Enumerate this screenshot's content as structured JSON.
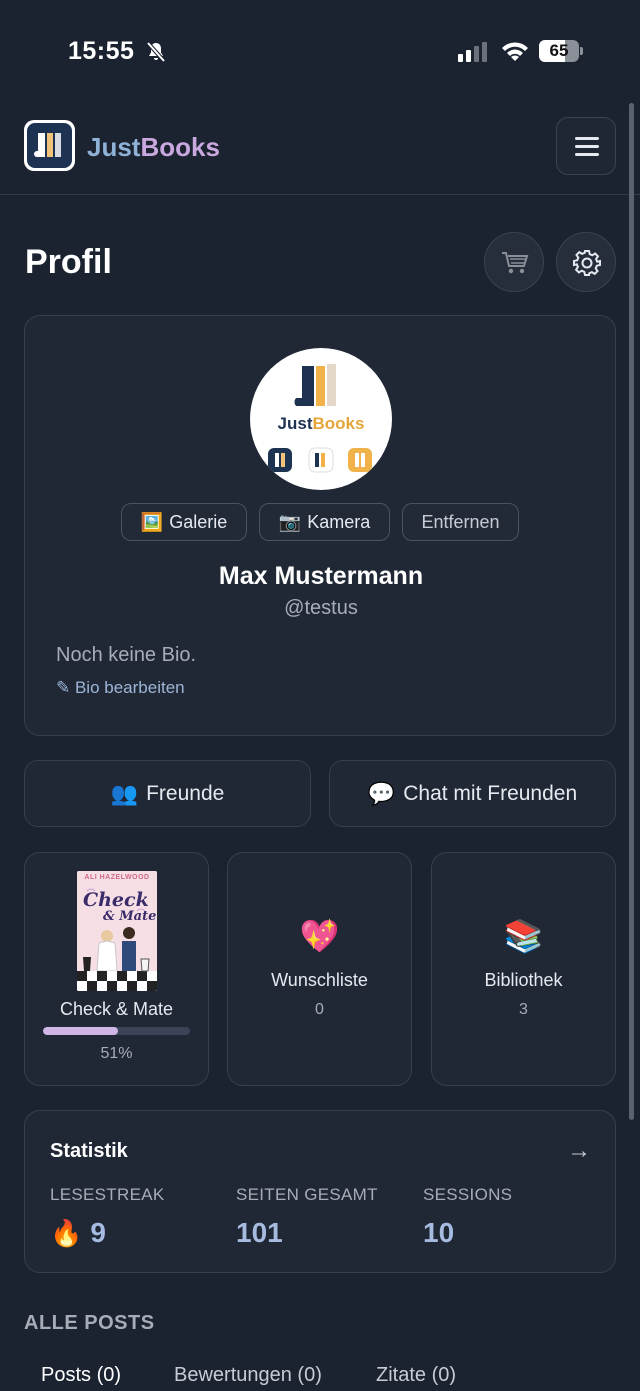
{
  "status_bar": {
    "time": "15:55",
    "battery_percent": "65",
    "battery_level": 0.65,
    "icons": [
      "bell-slash-icon",
      "signal-icon",
      "wifi-icon",
      "battery-icon"
    ]
  },
  "header": {
    "brand_part1": "Just",
    "brand_part2": "Books",
    "logo_icon": "justbooks-logo",
    "menu_icon": "hamburger-menu-icon"
  },
  "page": {
    "title": "Profil",
    "cart_icon": "cart-icon",
    "settings_icon": "gear-icon"
  },
  "profile": {
    "avatar_brand_part1": "Just",
    "avatar_brand_part2": "Books",
    "gallery_emoji": "🖼️",
    "gallery_label": "Galerie",
    "camera_emoji": "📷",
    "camera_label": "Kamera",
    "remove_label": "Entfernen",
    "name": "Max Mustermann",
    "handle": "@testus",
    "bio": "Noch keine Bio.",
    "edit_bio": "✎ Bio bearbeiten"
  },
  "actions": {
    "friends_emoji": "👥",
    "friends_label": "Freunde",
    "chat_emoji": "💬",
    "chat_label": "Chat mit Freunden"
  },
  "tiles": {
    "current_book": {
      "cover_author": "ALI HAZELWOOD",
      "cover_title_1": "Check",
      "cover_title_2": "& Mate",
      "title": "Check & Mate",
      "progress": 0.51,
      "progress_label": "51%"
    },
    "wishlist": {
      "emoji": "💖",
      "label": "Wunschliste",
      "count": "0"
    },
    "library": {
      "emoji": "📚",
      "label": "Bibliothek",
      "count": "3"
    }
  },
  "stats": {
    "title": "Statistik",
    "arrow": "→",
    "streak_label": "LESESTREAK",
    "streak_emoji": "🔥",
    "streak_value": "9",
    "pages_label": "SEITEN GESAMT",
    "pages_value": "101",
    "sessions_label": "SESSIONS",
    "sessions_value": "10"
  },
  "posts": {
    "section_title": "ALLE POSTS",
    "tabs": [
      "Posts (0)",
      "Bewertungen (0)",
      "Zitate (0)"
    ]
  },
  "colors": {
    "background": "#1b2230",
    "card": "#202735",
    "brand_blue": "#8fb2d6",
    "brand_purple": "#c9a8df",
    "stat_value": "#a6bbe0",
    "progress_fill": "#cfb6e6"
  }
}
